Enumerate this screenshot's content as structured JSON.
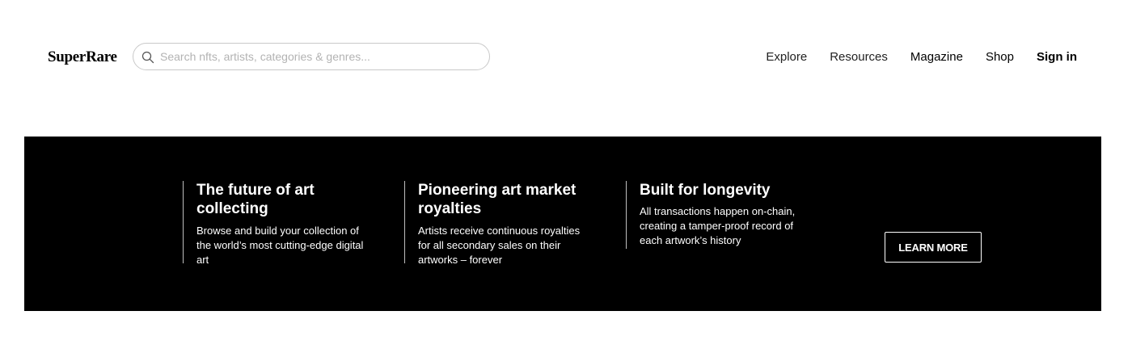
{
  "header": {
    "logo": "SuperRare",
    "search": {
      "placeholder": "Search nfts, artists, categories & genres...",
      "value": ""
    },
    "nav": {
      "explore": "Explore",
      "resources": "Resources",
      "magazine": "Magazine",
      "shop": "Shop",
      "sign_in": "Sign in"
    }
  },
  "banner": {
    "features": [
      {
        "title": "The future of art collecting",
        "description": "Browse and build your collection of the world’s most cutting-edge digital art"
      },
      {
        "title": "Pioneering art market royalties",
        "description": "Artists receive continuous royalties for all secondary sales on their artworks – forever"
      },
      {
        "title": "Built for longevity",
        "description": "All transactions happen on-chain, creating a tamper-proof record of each artwork’s history"
      }
    ],
    "cta_label": "LEARN MORE"
  },
  "colors": {
    "banner_background": "#000000",
    "search_border": "#c9c9c9",
    "placeholder": "#b3b3b3"
  }
}
